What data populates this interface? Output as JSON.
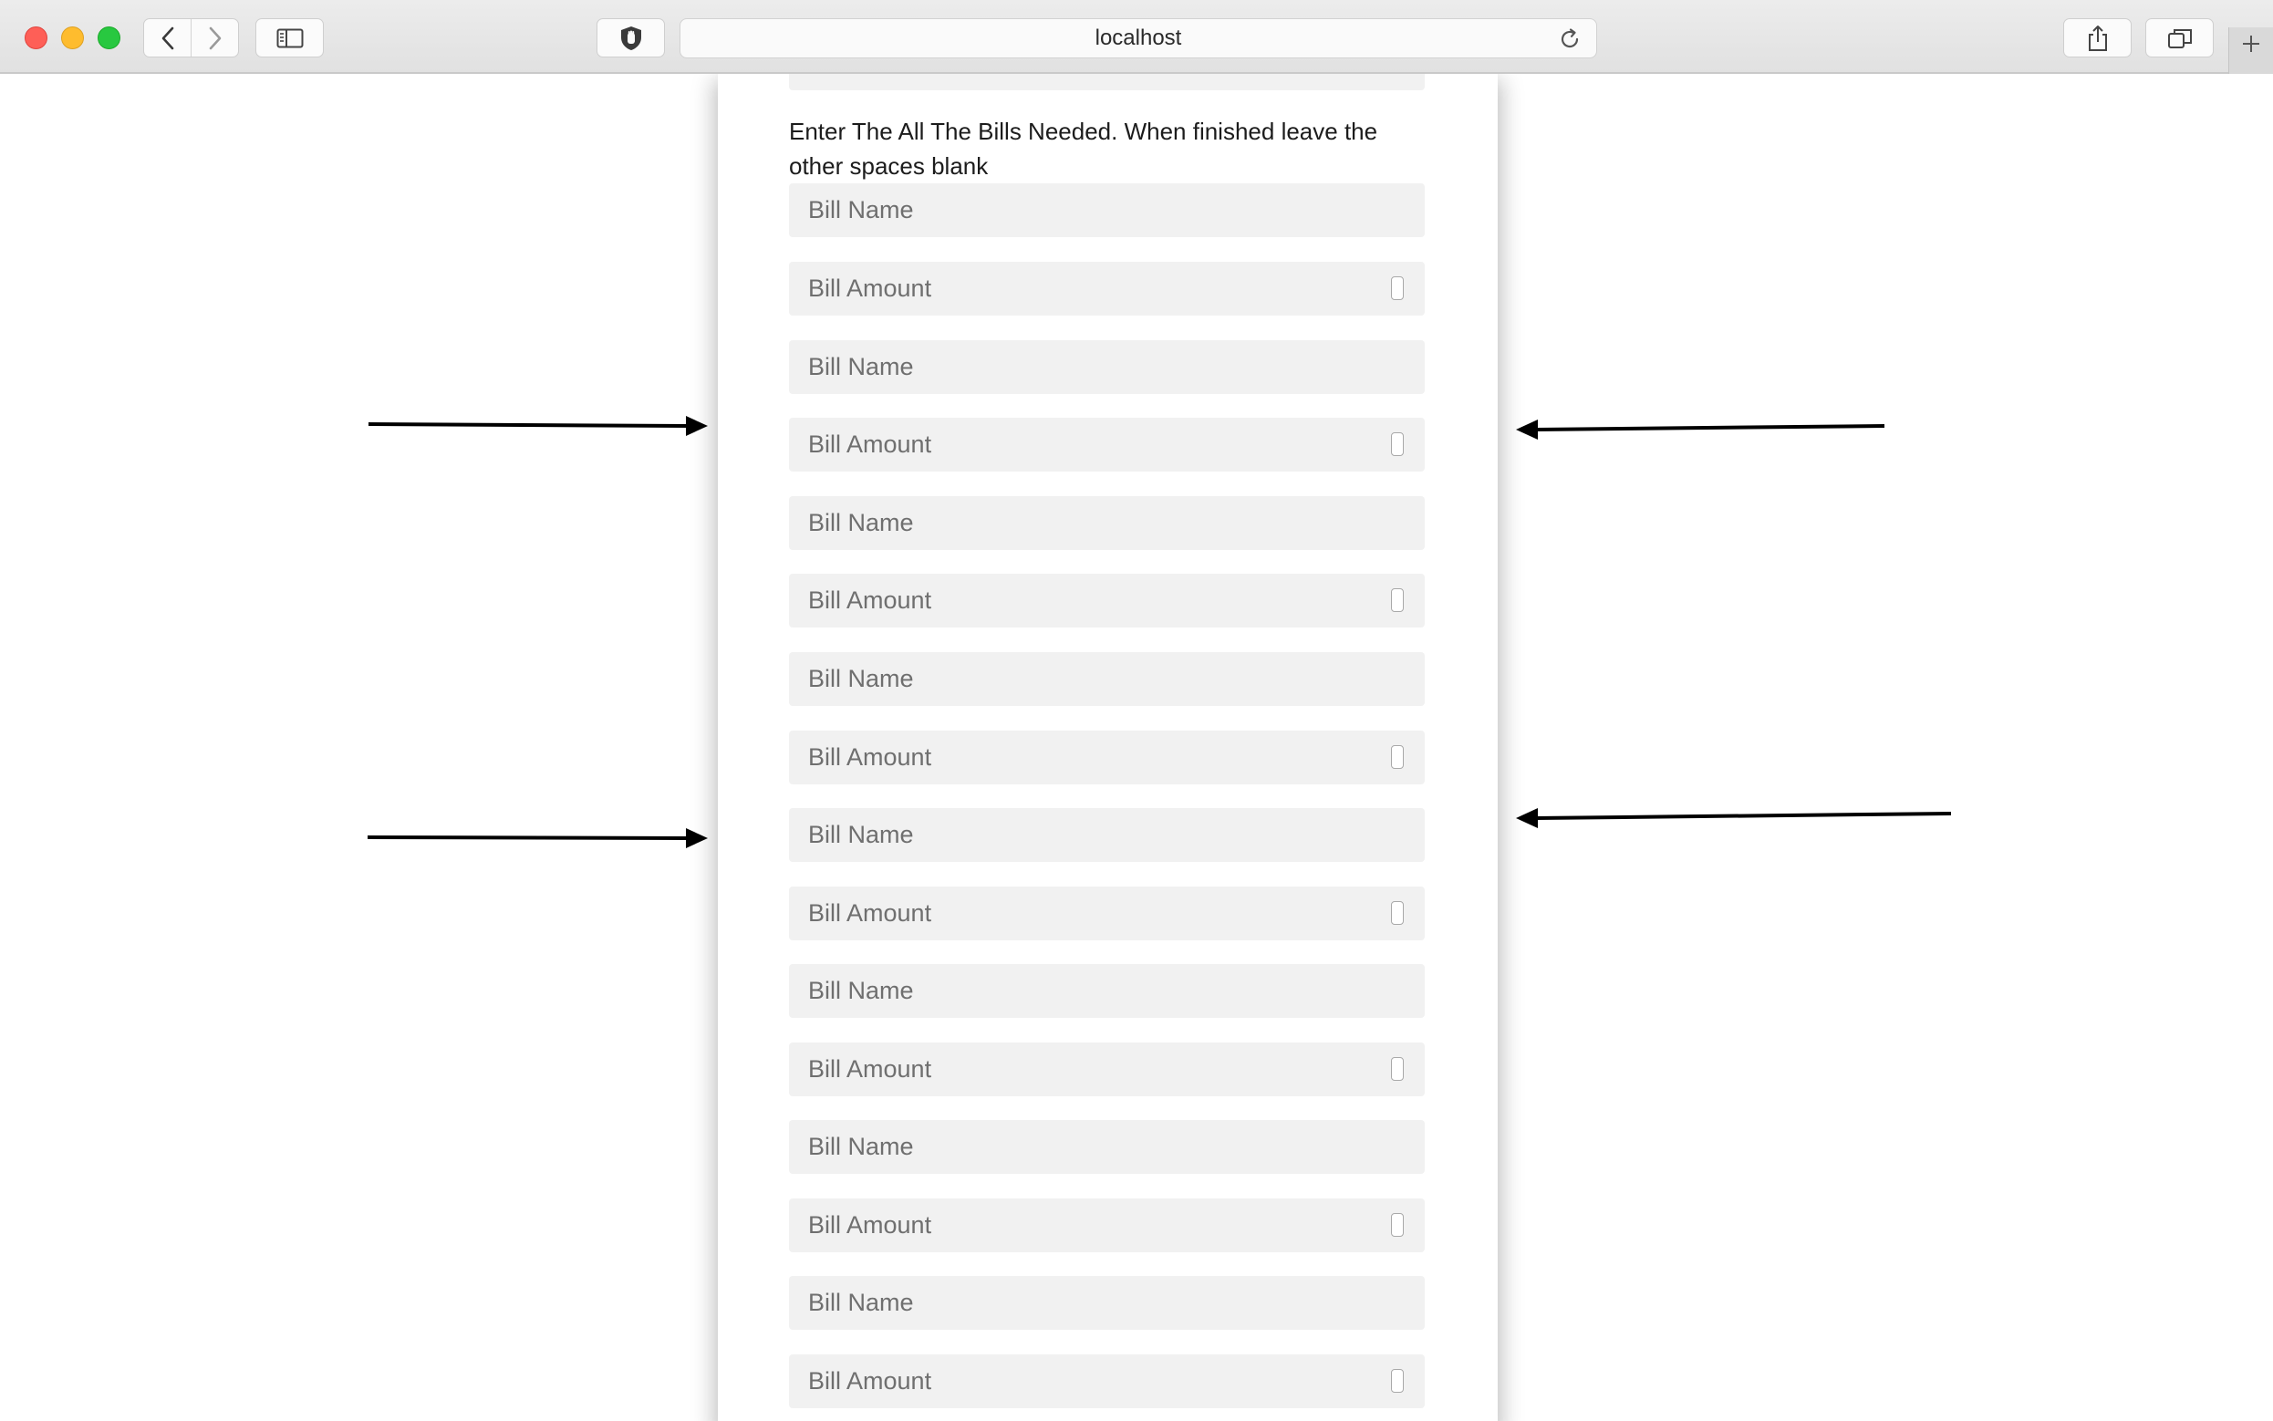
{
  "browser": {
    "url": "localhost",
    "icons": {
      "back": "chevron-left-icon",
      "forward": "chevron-right-icon",
      "sidebar": "sidebar-icon",
      "privacy": "shield-hand-icon",
      "reload": "reload-icon",
      "share": "share-icon",
      "tabs": "tabs-overview-icon",
      "new_tab": "plus-icon"
    }
  },
  "form": {
    "instructions": "Enter The All The Bills Needed. When finished leave the other spaces blank",
    "bills": [
      {
        "name_placeholder": "Bill Name",
        "amount_placeholder": "Bill Amount"
      },
      {
        "name_placeholder": "Bill Name",
        "amount_placeholder": "Bill Amount"
      },
      {
        "name_placeholder": "Bill Name",
        "amount_placeholder": "Bill Amount"
      },
      {
        "name_placeholder": "Bill Name",
        "amount_placeholder": "Bill Amount"
      },
      {
        "name_placeholder": "Bill Name",
        "amount_placeholder": "Bill Amount"
      },
      {
        "name_placeholder": "Bill Name",
        "amount_placeholder": "Bill Amount"
      },
      {
        "name_placeholder": "Bill Name",
        "amount_placeholder": "Bill Amount"
      },
      {
        "name_placeholder": "Bill Name",
        "amount_placeholder": "Bill Amount"
      }
    ]
  },
  "annotations": {
    "arrow_color": "#000000"
  }
}
